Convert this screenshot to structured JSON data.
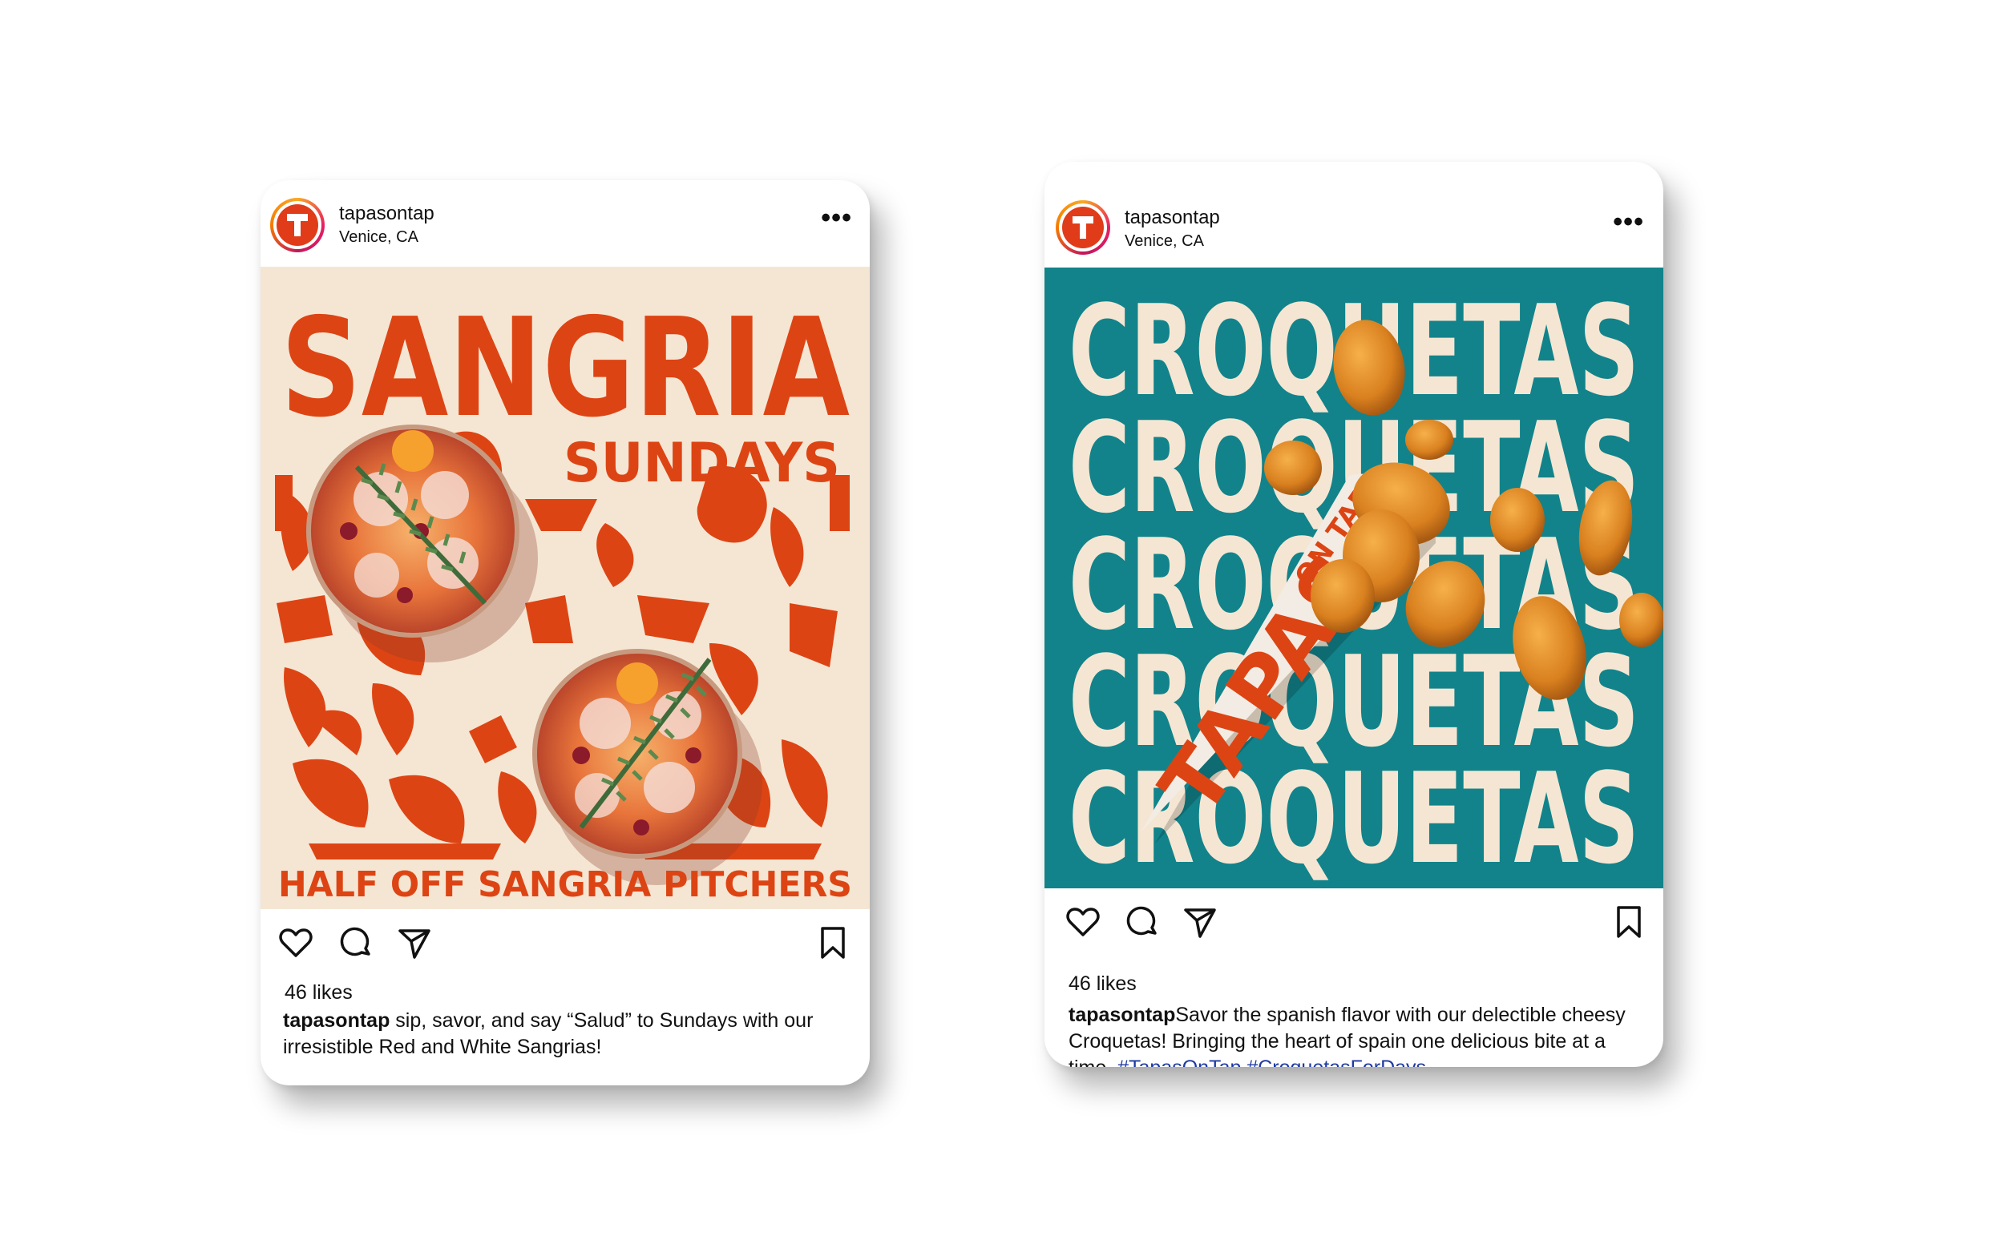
{
  "posts": [
    {
      "username": "tapasontap",
      "location": "Venice, CA",
      "more_label": "•••",
      "likes": "46 likes",
      "caption_user": "tapasontap",
      "caption_text": " sip, savor, and say “Salud” to Sundays with our irresistible Red and White Sangrias!",
      "image": {
        "headline": "SANGRIA",
        "subheadline": "SUNDAYS",
        "footer": "HALF OFF SANGRIA PITCHERS",
        "bg_color": "#f5e6d3",
        "accent_color": "#dd4414"
      },
      "icons": [
        "heart-icon",
        "comment-icon",
        "share-icon",
        "bookmark-icon"
      ]
    },
    {
      "username": "tapasontap",
      "location": "Venice, CA",
      "more_label": "•••",
      "likes": "46 likes",
      "caption_user": "tapasontap",
      "caption_text": "Savor the spanish flavor with our delectible cheesy Croquetas! Bringing the heart of spain one delicious bite at a time. ",
      "caption_tags": "#TapasOnTap #CroquetasForDays",
      "image": {
        "repeated_word": "CROQUETAS",
        "cone_text_small": "ON TAP",
        "cone_text_big": "TAPAS",
        "bg_color": "#12838a",
        "text_color": "#f5e6d3"
      },
      "icons": [
        "heart-icon",
        "comment-icon",
        "share-icon",
        "bookmark-icon"
      ]
    }
  ]
}
